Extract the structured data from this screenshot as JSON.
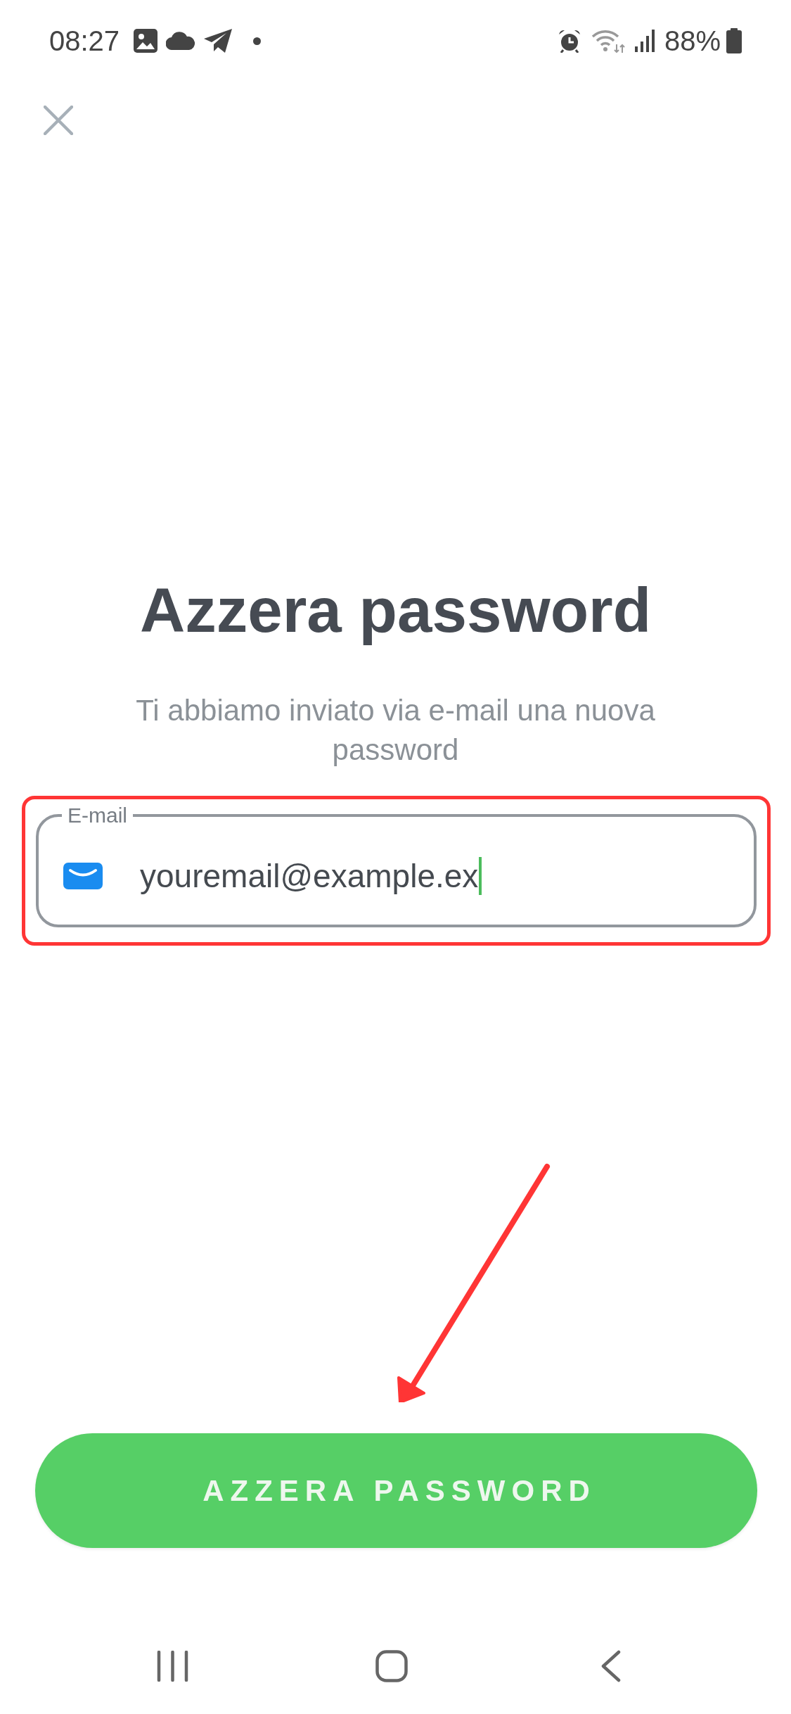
{
  "status_bar": {
    "time": "08:27",
    "battery": "88%"
  },
  "title": "Azzera password",
  "subtitle": "Ti abbiamo inviato via e-mail una nuova password",
  "email_field": {
    "label": "E-mail",
    "value": "youremail@example.ex",
    "focused": true,
    "highlighted": true
  },
  "primary_button": {
    "label": "AZZERA PASSWORD"
  }
}
